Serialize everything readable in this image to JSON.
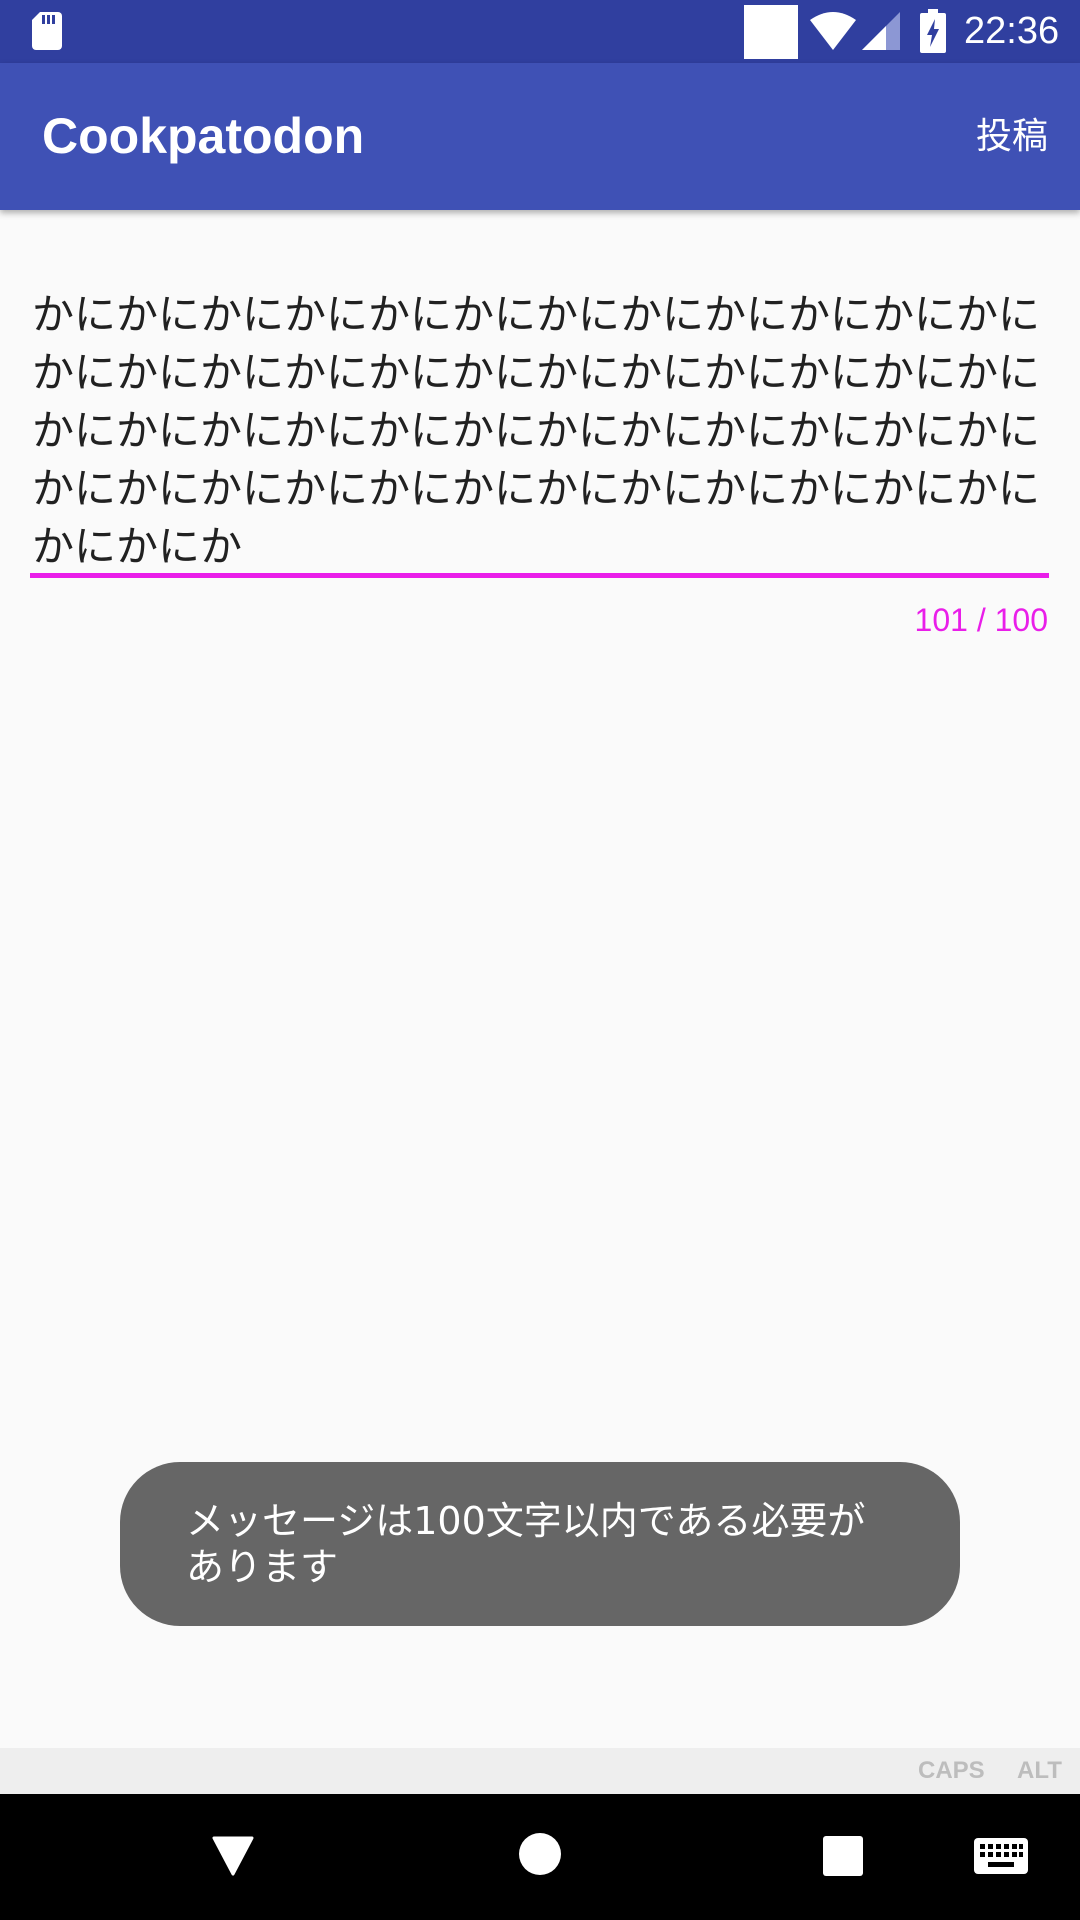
{
  "status_bar": {
    "time": "22:36",
    "icons": [
      "sd-card-icon",
      "notification-square-icon",
      "wifi-icon",
      "signal-icon",
      "battery-charging-icon"
    ]
  },
  "app_bar": {
    "title": "Cookpatodon",
    "post_label": "投稿"
  },
  "compose": {
    "message": "かにかにかにかにかにかにかにかにかにかにかにかにかにかにかにかにかにかにかにかにかにかにかにかにかにかにかにかにかにかにかにかにかにかにかにかにかにかにかにかにかにかにかにかにかにかにかにかにかにかにか",
    "counter": "101 / 100",
    "error_color": "#e91ee9"
  },
  "toast": {
    "message": "メッセージは100文字以内である必要があります"
  },
  "ime_bar": {
    "caps_label": "CAPS",
    "alt_label": "ALT"
  },
  "nav_bar": {
    "icons": [
      "back-icon",
      "home-icon",
      "recents-icon",
      "keyboard-icon"
    ]
  },
  "colors": {
    "status_bar": "#303f9f",
    "app_bar": "#3f51b5",
    "background": "#fafafa",
    "toast": "#666666"
  }
}
